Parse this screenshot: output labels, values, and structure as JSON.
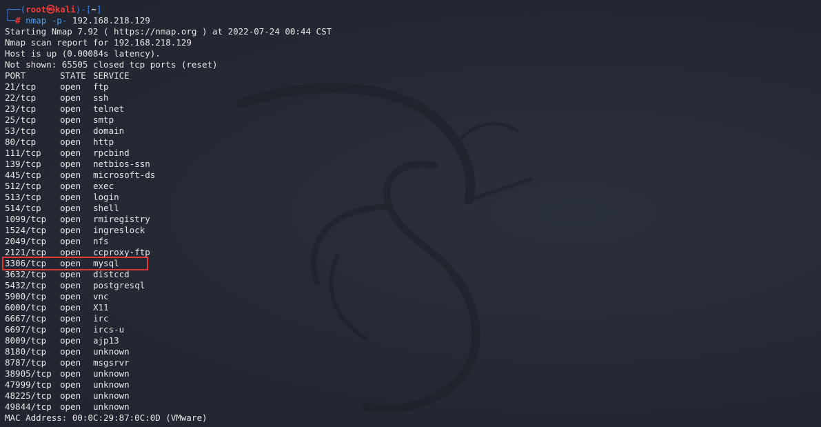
{
  "prompt": {
    "open": "┌──(",
    "user": "root㉿kali",
    "mid": ")-[",
    "dir": "~",
    "close": "]",
    "line2_prefix": "└─",
    "hash": "#",
    "command": "nmap",
    "arg": "-p-",
    "target": "192.168.218.129"
  },
  "output_header": [
    "Starting Nmap 7.92 ( https://nmap.org ) at 2022-07-24 00:44 CST",
    "Nmap scan report for 192.168.218.129",
    "Host is up (0.00084s latency).",
    "Not shown: 65505 closed tcp ports (reset)"
  ],
  "table_header": {
    "port": "PORT",
    "state": "STATE",
    "service": "SERVICE"
  },
  "ports": [
    {
      "port": "21/tcp",
      "state": "open",
      "service": "ftp"
    },
    {
      "port": "22/tcp",
      "state": "open",
      "service": "ssh"
    },
    {
      "port": "23/tcp",
      "state": "open",
      "service": "telnet"
    },
    {
      "port": "25/tcp",
      "state": "open",
      "service": "smtp"
    },
    {
      "port": "53/tcp",
      "state": "open",
      "service": "domain"
    },
    {
      "port": "80/tcp",
      "state": "open",
      "service": "http"
    },
    {
      "port": "111/tcp",
      "state": "open",
      "service": "rpcbind"
    },
    {
      "port": "139/tcp",
      "state": "open",
      "service": "netbios-ssn"
    },
    {
      "port": "445/tcp",
      "state": "open",
      "service": "microsoft-ds"
    },
    {
      "port": "512/tcp",
      "state": "open",
      "service": "exec"
    },
    {
      "port": "513/tcp",
      "state": "open",
      "service": "login"
    },
    {
      "port": "514/tcp",
      "state": "open",
      "service": "shell"
    },
    {
      "port": "1099/tcp",
      "state": "open",
      "service": "rmiregistry"
    },
    {
      "port": "1524/tcp",
      "state": "open",
      "service": "ingreslock"
    },
    {
      "port": "2049/tcp",
      "state": "open",
      "service": "nfs"
    },
    {
      "port": "2121/tcp",
      "state": "open",
      "service": "ccproxy-ftp"
    },
    {
      "port": "3306/tcp",
      "state": "open",
      "service": "mysql"
    },
    {
      "port": "3632/tcp",
      "state": "open",
      "service": "distccd"
    },
    {
      "port": "5432/tcp",
      "state": "open",
      "service": "postgresql"
    },
    {
      "port": "5900/tcp",
      "state": "open",
      "service": "vnc"
    },
    {
      "port": "6000/tcp",
      "state": "open",
      "service": "X11"
    },
    {
      "port": "6667/tcp",
      "state": "open",
      "service": "irc"
    },
    {
      "port": "6697/tcp",
      "state": "open",
      "service": "ircs-u"
    },
    {
      "port": "8009/tcp",
      "state": "open",
      "service": "ajp13"
    },
    {
      "port": "8180/tcp",
      "state": "open",
      "service": "unknown"
    },
    {
      "port": "8787/tcp",
      "state": "open",
      "service": "msgsrvr"
    },
    {
      "port": "38905/tcp",
      "state": "open",
      "service": "unknown"
    },
    {
      "port": "47999/tcp",
      "state": "open",
      "service": "unknown"
    },
    {
      "port": "48225/tcp",
      "state": "open",
      "service": "unknown"
    },
    {
      "port": "49844/tcp",
      "state": "open",
      "service": "unknown"
    }
  ],
  "footer": "MAC Address: 00:0C:29:87:0C:0D (VMware)",
  "colors": {
    "background": "#252a34",
    "prompt_frame": "#3b7cf0",
    "prompt_user": "#ef3b3b",
    "command": "#4aa0f5",
    "text": "#e6e6e6",
    "highlight": "#e53935"
  },
  "background_icon": "kali-dragon-icon"
}
